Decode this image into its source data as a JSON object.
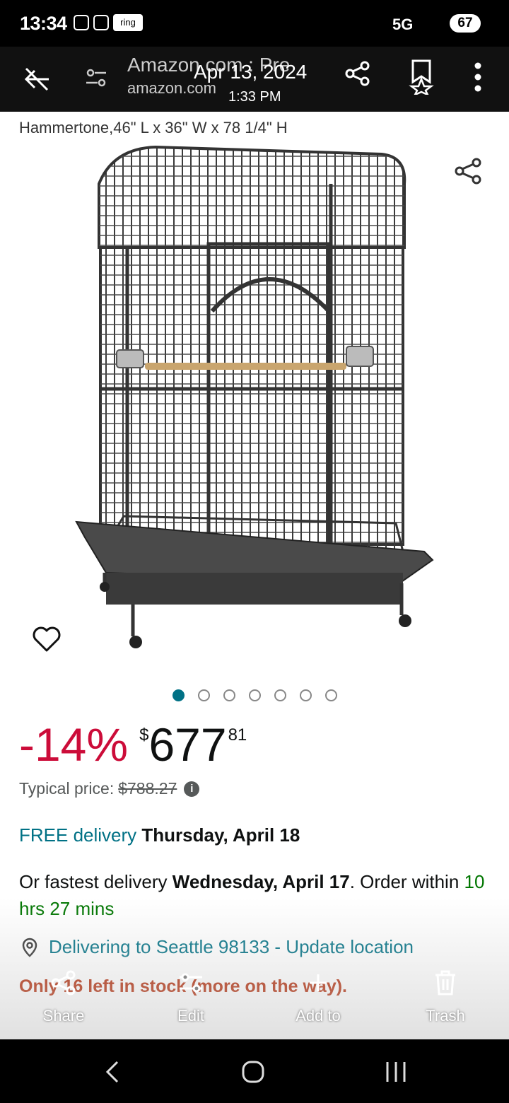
{
  "status_bar": {
    "time": "13:34",
    "ring_label": "ring",
    "network": "5G",
    "battery": "67"
  },
  "top_bar": {
    "page_title": "Amazon.com : Pre",
    "host": "amazon.com",
    "date": "Apr 13, 2024",
    "time": "1:33 PM"
  },
  "product": {
    "title_fragment": "Hammertone,46\" L x 36\" W x 78 1/4\" H",
    "image_count": 7,
    "active_image_index": 0
  },
  "price": {
    "discount": "-14%",
    "currency": "$",
    "whole": "677",
    "fraction": "81",
    "typical_label": "Typical price:",
    "typical_value": "$788.27"
  },
  "delivery": {
    "free_label": "FREE delivery",
    "free_date": "Thursday, April 18",
    "fast_prefix": "Or fastest delivery",
    "fast_date": "Wednesday, April 17",
    "order_within": ". Order within",
    "countdown": "10 hrs 27 mins",
    "location": "Delivering to Seattle 98133 - Update location"
  },
  "stock": "Only 16 left in stock (more on the way).",
  "actions": {
    "share": "Share",
    "edit": "Edit",
    "add_to": "Add to",
    "trash": "Trash"
  },
  "colors": {
    "discount": "#cc0c39",
    "link": "#007185",
    "green": "#007600",
    "stock": "#b12704"
  }
}
